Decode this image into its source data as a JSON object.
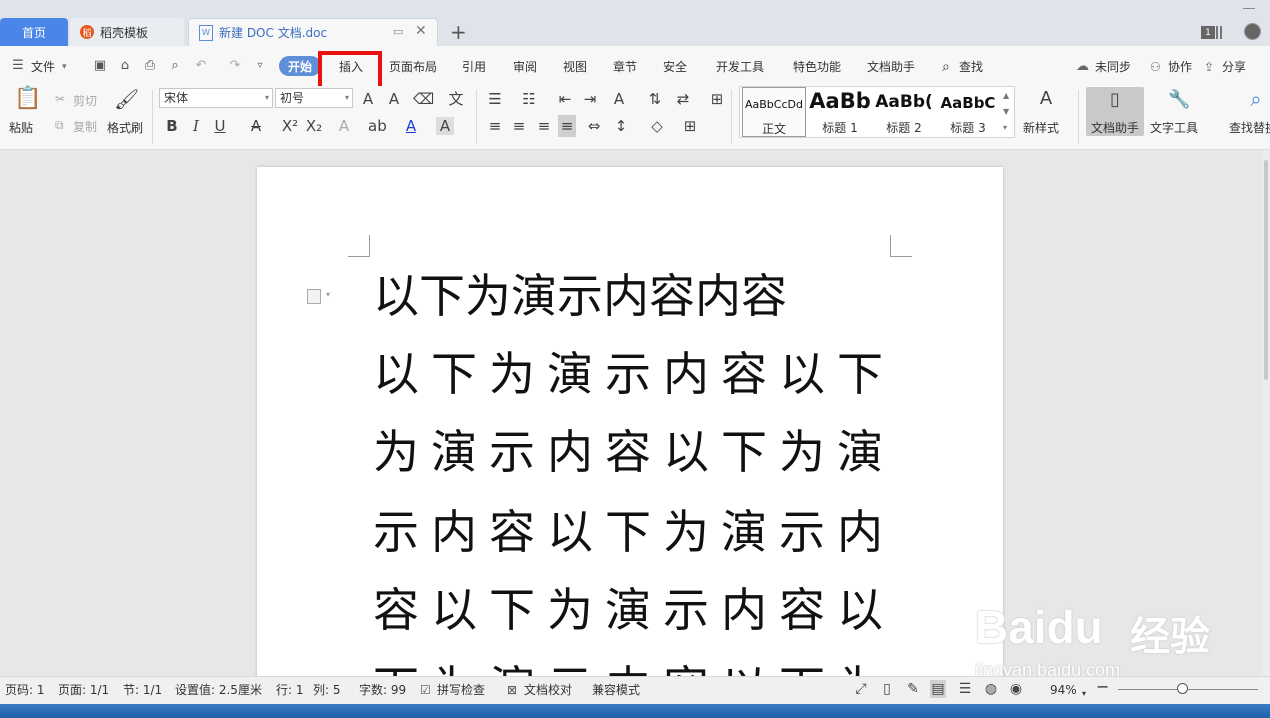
{
  "tabs": {
    "home": "首页",
    "template": "稻壳模板",
    "document": "新建 DOC 文档.doc",
    "window_count": "1"
  },
  "menu": {
    "file": "文件",
    "items": [
      "开始",
      "插入",
      "页面布局",
      "引用",
      "审阅",
      "视图",
      "章节",
      "安全",
      "开发工具",
      "特色功能",
      "文档助手",
      "查找"
    ],
    "highlighted_item": "插入",
    "right": {
      "sync": "未同步",
      "collab": "协作",
      "share": "分享"
    }
  },
  "ribbon": {
    "paste": "粘贴",
    "cut": "剪切",
    "copy": "复制",
    "format_painter": "格式刷",
    "font_name": "宋体",
    "font_size": "初号",
    "styles": [
      {
        "sample": "AaBbCcDd",
        "name": "正文"
      },
      {
        "sample": "AaBb",
        "name": "标题 1"
      },
      {
        "sample": "AaBb(",
        "name": "标题 2"
      },
      {
        "sample": "AaBbC",
        "name": "标题 3"
      }
    ],
    "new_style": "新样式",
    "doc_helper": "文档助手",
    "text_tools": "文字工具",
    "find_replace": "查找替换"
  },
  "document": {
    "lines": [
      "以下为演示内容内容",
      "以下为演示内容以下",
      "为演示内容以下为演",
      "示内容以下为演示内",
      "容以下为演示内容以",
      "下为演示内容以下为"
    ]
  },
  "watermark": {
    "brand": "Baidu",
    "cn": "经验",
    "url": "jingyan.baidu.com"
  },
  "status": {
    "page_no": "页码: 1",
    "pages": "页面: 1/1",
    "section": "节: 1/1",
    "setting": "设置值: 2.5厘米",
    "row": "行: 1",
    "col": "列: 5",
    "words": "字数: 99",
    "spell": "拼写检查",
    "proof": "文档校对",
    "compat": "兼容模式",
    "zoom": "94%"
  },
  "colors": {
    "accent": "#4a86e8",
    "highlight": "#e8130f",
    "font_color": "#1f3bd6"
  }
}
